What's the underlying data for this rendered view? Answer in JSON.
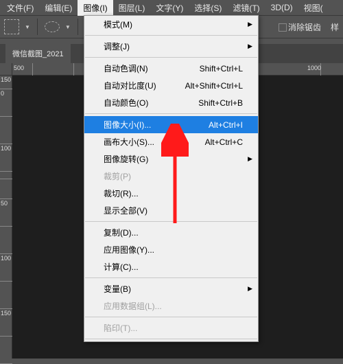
{
  "menubar": {
    "items": [
      {
        "label": "文件(F)"
      },
      {
        "label": "编辑(E)"
      },
      {
        "label": "图像(I)"
      },
      {
        "label": "图层(L)"
      },
      {
        "label": "文字(Y)"
      },
      {
        "label": "选择(S)"
      },
      {
        "label": "滤镜(T)"
      },
      {
        "label": "3D(D)"
      },
      {
        "label": "视图("
      }
    ],
    "open_index": 2
  },
  "toolbar": {
    "antialias_label": "消除锯齿",
    "style_label": "样"
  },
  "tab": {
    "title": "微信截图_2021"
  },
  "ruler_h": [
    "500",
    "",
    "",
    "",
    "",
    "1000"
  ],
  "ruler_v": [
    "150",
    "0",
    "",
    "100",
    "",
    "",
    "",
    "50",
    "",
    "100",
    "",
    "150",
    ""
  ],
  "dropdown": {
    "sections": [
      [
        {
          "label": "模式(M)",
          "sub": true
        }
      ],
      [
        {
          "label": "调整(J)",
          "sub": true
        }
      ],
      [
        {
          "label": "自动色调(N)",
          "shortcut": "Shift+Ctrl+L"
        },
        {
          "label": "自动对比度(U)",
          "shortcut": "Alt+Shift+Ctrl+L"
        },
        {
          "label": "自动颜色(O)",
          "shortcut": "Shift+Ctrl+B"
        }
      ],
      [
        {
          "label": "图像大小(I)...",
          "shortcut": "Alt+Ctrl+I",
          "highlight": true
        },
        {
          "label": "画布大小(S)...",
          "shortcut": "Alt+Ctrl+C"
        },
        {
          "label": "图像旋转(G)",
          "sub": true
        },
        {
          "label": "裁剪(P)",
          "disabled": true
        },
        {
          "label": "裁切(R)..."
        },
        {
          "label": "显示全部(V)"
        }
      ],
      [
        {
          "label": "复制(D)..."
        },
        {
          "label": "应用图像(Y)..."
        },
        {
          "label": "计算(C)..."
        }
      ],
      [
        {
          "label": "变量(B)",
          "sub": true
        },
        {
          "label": "应用数据组(L)...",
          "disabled": true
        }
      ],
      [
        {
          "label": "陷印(T)...",
          "disabled": true
        }
      ]
    ]
  }
}
